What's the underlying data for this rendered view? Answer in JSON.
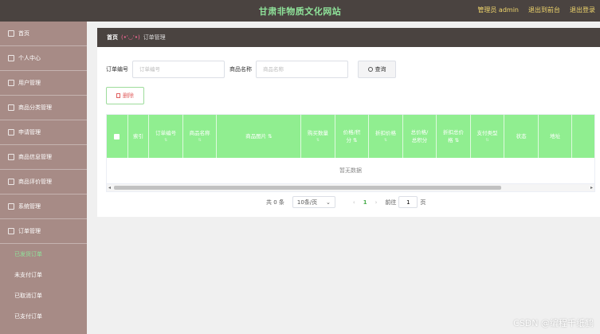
{
  "header": {
    "title": "甘肃非物质文化网站",
    "admin_label": "管理员 admin",
    "back_link": "退出到前台",
    "logout_link": "退出登录"
  },
  "sidebar": {
    "items": [
      {
        "label": "首页"
      },
      {
        "label": "个人中心"
      },
      {
        "label": "用户管理"
      },
      {
        "label": "商品分类管理"
      },
      {
        "label": "申请管理"
      },
      {
        "label": "商品信息管理"
      },
      {
        "label": "商品评价管理"
      },
      {
        "label": "系统管理"
      },
      {
        "label": "订单管理"
      }
    ],
    "sub_items": [
      {
        "label": "已发货订单",
        "active": true
      },
      {
        "label": "未支付订单"
      },
      {
        "label": "已取消订单"
      },
      {
        "label": "已支付订单"
      }
    ]
  },
  "breadcrumb": {
    "home": "首页",
    "face": "(•'◡'•)",
    "current": "订单管理"
  },
  "filters": {
    "order_no_label": "订单编号",
    "order_no_placeholder": "订单编号",
    "product_label": "商品名称",
    "product_placeholder": "商品名称",
    "search_label": "查询"
  },
  "actions": {
    "delete_label": "删除"
  },
  "table": {
    "columns": [
      {
        "l1": "",
        "l2": ""
      },
      {
        "l1": "索引",
        "l2": ""
      },
      {
        "l1": "订单编号",
        "l2": "⇅"
      },
      {
        "l1": "商品名称",
        "l2": "⇅"
      },
      {
        "l1": "商品图片 ⇅",
        "l2": ""
      },
      {
        "l1": "购买数量",
        "l2": "⇅"
      },
      {
        "l1": "价格/积",
        "l2": "分 ⇅"
      },
      {
        "l1": "折扣价格",
        "l2": "⇅"
      },
      {
        "l1": "总价格/",
        "l2": "总积分"
      },
      {
        "l1": "折扣总价",
        "l2": "格 ⇅"
      },
      {
        "l1": "支付类型",
        "l2": "⇅"
      },
      {
        "l1": "状态",
        "l2": ""
      },
      {
        "l1": "地址",
        "l2": ""
      },
      {
        "l1": "",
        "l2": ""
      }
    ],
    "empty_text": "暂无数据"
  },
  "pagination": {
    "total": "共 0 条",
    "page_size": "10条/页",
    "current_page": "1",
    "goto_label": "前往",
    "goto_value": "1",
    "page_suffix": "页"
  },
  "watermark": "CSDN @编程千纸鹤"
}
